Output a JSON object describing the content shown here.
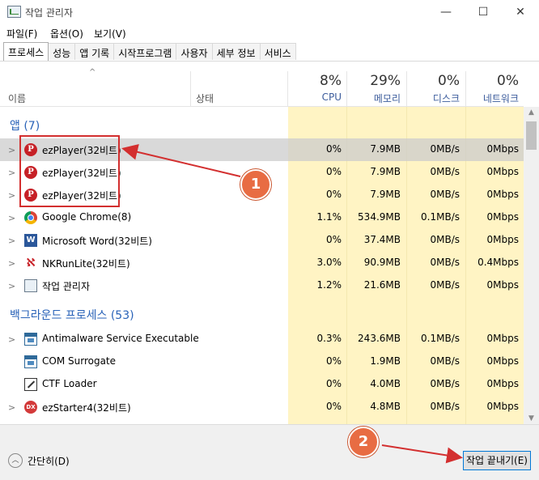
{
  "window": {
    "title": "작업 관리자",
    "minimize": "—",
    "maximize": "☐",
    "close": "✕"
  },
  "menu": [
    "파일(F)",
    "옵션(O)",
    "보기(V)"
  ],
  "tabs": [
    "프로세스",
    "성능",
    "앱 기록",
    "시작프로그램",
    "사용자",
    "세부 정보",
    "서비스"
  ],
  "header": {
    "sort_arrow": "^",
    "name": "이름",
    "status": "상태",
    "cpu_pct": "8%",
    "cpu": "CPU",
    "mem_pct": "29%",
    "mem": "메모리",
    "disk_pct": "0%",
    "disk": "디스크",
    "net_pct": "0%",
    "net": "네트워크"
  },
  "groups": {
    "apps": "앱 (7)",
    "background": "백그라운드 프로세스 (53)"
  },
  "apps": [
    {
      "name": "ezPlayer(32비트)",
      "icon": "ezplayer-icon",
      "cpu": "0%",
      "mem": "7.9MB",
      "disk": "0MB/s",
      "net": "0Mbps"
    },
    {
      "name": "ezPlayer(32비트)",
      "icon": "ezplayer-icon",
      "cpu": "0%",
      "mem": "7.9MB",
      "disk": "0MB/s",
      "net": "0Mbps"
    },
    {
      "name": "ezPlayer(32비트)",
      "icon": "ezplayer-icon",
      "cpu": "0%",
      "mem": "7.9MB",
      "disk": "0MB/s",
      "net": "0Mbps"
    },
    {
      "name": "Google Chrome(8)",
      "icon": "chrome-icon",
      "cpu": "1.1%",
      "mem": "534.9MB",
      "disk": "0.1MB/s",
      "net": "0Mbps"
    },
    {
      "name": "Microsoft Word(32비트)",
      "icon": "word-icon",
      "cpu": "0%",
      "mem": "37.4MB",
      "disk": "0MB/s",
      "net": "0Mbps"
    },
    {
      "name": "NKRunLite(32비트)",
      "icon": "nkrunlite-icon",
      "cpu": "3.0%",
      "mem": "90.9MB",
      "disk": "0MB/s",
      "net": "0.4Mbps"
    },
    {
      "name": "작업 관리자",
      "icon": "task-manager-icon",
      "cpu": "1.2%",
      "mem": "21.6MB",
      "disk": "0MB/s",
      "net": "0Mbps"
    }
  ],
  "background": [
    {
      "name": "Antimalware Service Executable",
      "icon": "service-icon",
      "cpu": "0.3%",
      "mem": "243.6MB",
      "disk": "0.1MB/s",
      "net": "0Mbps"
    },
    {
      "name": "COM Surrogate",
      "icon": "service-icon",
      "cpu": "0%",
      "mem": "1.9MB",
      "disk": "0MB/s",
      "net": "0Mbps"
    },
    {
      "name": "CTF Loader",
      "icon": "ctf-icon",
      "cpu": "0%",
      "mem": "4.0MB",
      "disk": "0MB/s",
      "net": "0Mbps"
    },
    {
      "name": "ezStarter4(32비트)",
      "icon": "ezstarter-icon",
      "cpu": "0%",
      "mem": "4.8MB",
      "disk": "0MB/s",
      "net": "0Mbps"
    }
  ],
  "icon_glyphs": {
    "ezplayer": "P",
    "word": "W",
    "nkrunlite": "ℵ",
    "ezstarter": "DX"
  },
  "footer": {
    "fewer_details": "간단히(D)",
    "end_task": "작업 끝내기(E)"
  },
  "annotations": {
    "badge1": "1",
    "badge2": "2"
  },
  "colors": {
    "usage_bg": "#fff4c4",
    "group_text": "#2a63b8",
    "highlight": "#d32f2f",
    "badge": "#e86c43"
  }
}
